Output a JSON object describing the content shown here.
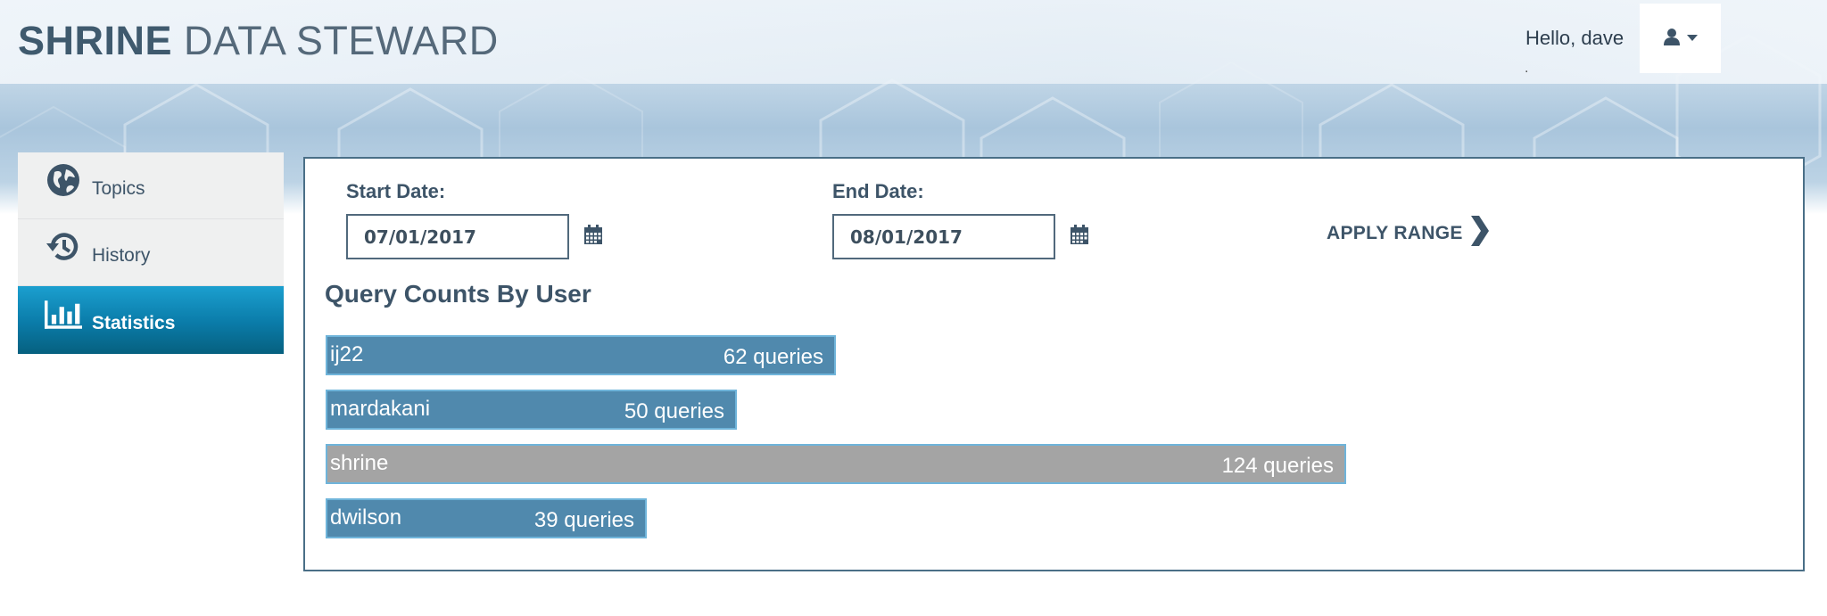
{
  "app": {
    "brand_bold": "SHRINE",
    "brand_light": "DATA STEWARD"
  },
  "header": {
    "greeting": "Hello, dave",
    "greeting_sub": ".",
    "user_menu_icon": "user-icon",
    "caret_icon": "caret-down-icon"
  },
  "sidebar": {
    "items": [
      {
        "label": "Topics",
        "icon": "globe-icon",
        "active": false
      },
      {
        "label": "History",
        "icon": "history-icon",
        "active": false
      },
      {
        "label": "Statistics",
        "icon": "bar-chart-icon",
        "active": true
      }
    ]
  },
  "filters": {
    "start_label": "Start Date:",
    "start_value": "07/01/2017",
    "end_label": "End Date:",
    "end_value": "08/01/2017",
    "apply_label": "APPLY RANGE"
  },
  "chart_data": {
    "type": "bar",
    "orientation": "horizontal",
    "title": "Query Counts By User",
    "categories": [
      "ij22",
      "mardakani",
      "shrine",
      "dwilson"
    ],
    "values": [
      62,
      50,
      124,
      39
    ],
    "labels": [
      "62 queries",
      "50 queries",
      "124 queries",
      "39 queries"
    ],
    "colors": [
      "#5089ad",
      "#5089ad",
      "#a4a4a4",
      "#5089ad"
    ],
    "xlim": [
      0,
      124
    ],
    "grid": false
  }
}
